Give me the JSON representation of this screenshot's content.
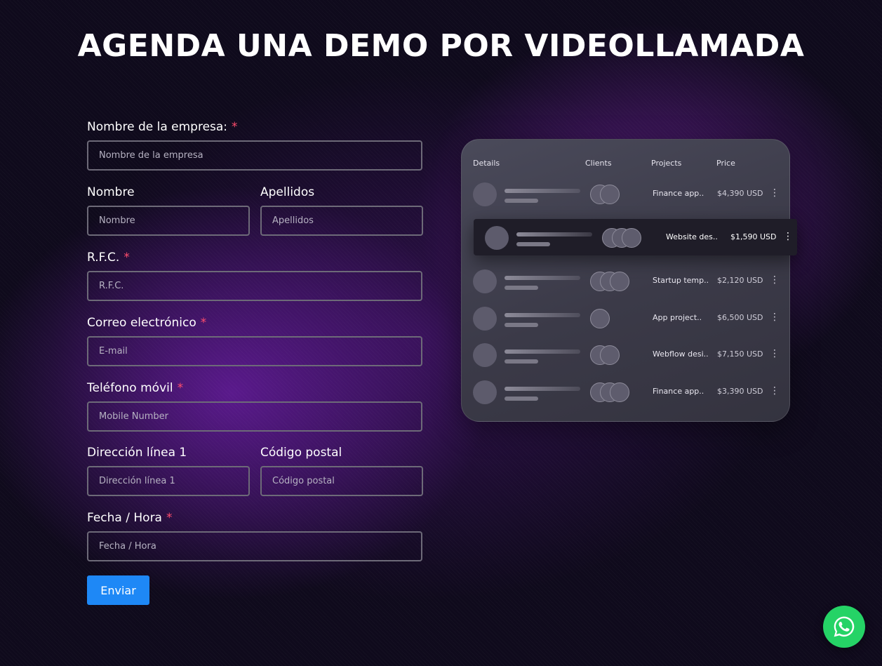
{
  "page": {
    "title": "AGENDA UNA DEMO POR VIDEOLLAMADA"
  },
  "form": {
    "company": {
      "label": "Nombre de la empresa:",
      "required": "*",
      "placeholder": "Nombre de la empresa"
    },
    "first_name": {
      "label": "Nombre",
      "placeholder": "Nombre"
    },
    "last_name": {
      "label": "Apellidos",
      "placeholder": "Apellidos"
    },
    "rfc": {
      "label": "R.F.C.",
      "required": "*",
      "placeholder": "R.F.C."
    },
    "email": {
      "label": "Correo electrónico",
      "required": "*",
      "placeholder": "E-mail"
    },
    "phone": {
      "label": "Teléfono móvil",
      "required": "*",
      "placeholder": "Mobile Number"
    },
    "address": {
      "label": "Dirección línea 1",
      "placeholder": "Dirección línea 1"
    },
    "postal": {
      "label": "Código postal",
      "placeholder": "Código postal"
    },
    "datetime": {
      "label": "Fecha / Hora",
      "required": "*",
      "placeholder": "Fecha / Hora"
    },
    "submit_label": "Enviar"
  },
  "preview": {
    "headers": {
      "details": "Details",
      "clients": "Clients",
      "projects": "Projects",
      "price": "Price"
    },
    "rows": [
      {
        "project": "Finance app..",
        "price": "$4,390 USD",
        "clients": 2
      },
      {
        "project": "Website des..",
        "price": "$1,590 USD",
        "clients": 3
      },
      {
        "project": "Startup temp..",
        "price": "$2,120 USD",
        "clients": 3
      },
      {
        "project": "App project..",
        "price": "$6,500 USD",
        "clients": 1
      },
      {
        "project": "Webflow desi..",
        "price": "$7,150 USD",
        "clients": 2
      },
      {
        "project": "Finance app..",
        "price": "$3,390 USD",
        "clients": 3
      }
    ],
    "menu_glyph": "⋮"
  },
  "whatsapp": {
    "icon": "whatsapp-icon",
    "color": "#25d366"
  },
  "colors": {
    "accent": "#1e88f6",
    "required": "#ff4d6d"
  }
}
